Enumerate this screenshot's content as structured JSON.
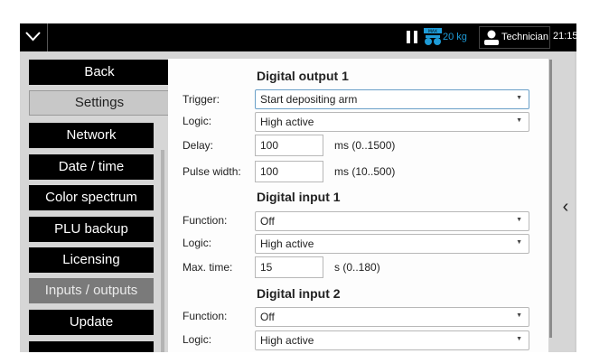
{
  "topbar": {
    "menu_icon": "chevron-down-icon",
    "pause_icon": "pause-icon",
    "scale_icon": "scale-max-icon",
    "scale_weight": "20 kg",
    "user_icon": "user-icon",
    "user_role": "Technician",
    "time": "21:15"
  },
  "sidebar": {
    "back_label": "Back",
    "settings_label": "Settings",
    "items": [
      {
        "label": "Network"
      },
      {
        "label": "Date / time"
      },
      {
        "label": "Color spectrum"
      },
      {
        "label": "PLU backup"
      },
      {
        "label": "Licensing"
      },
      {
        "label": "Inputs / outputs",
        "active": true
      },
      {
        "label": "Update"
      }
    ]
  },
  "form": {
    "digital_output_1": {
      "title": "Digital output 1",
      "trigger_label": "Trigger:",
      "trigger_value": "Start depositing arm",
      "logic_label": "Logic:",
      "logic_value": "High active",
      "delay_label": "Delay:",
      "delay_value": "100",
      "delay_range": "ms (0..1500)",
      "pulse_label": "Pulse width:",
      "pulse_value": "100",
      "pulse_range": "ms (10..500)"
    },
    "digital_input_1": {
      "title": "Digital input 1",
      "function_label": "Function:",
      "function_value": "Off",
      "logic_label": "Logic:",
      "logic_value": "High active",
      "maxtime_label": "Max. time:",
      "maxtime_value": "15",
      "maxtime_range": "s (0..180)"
    },
    "digital_input_2": {
      "title": "Digital input 2",
      "function_label": "Function:",
      "function_value": "Off",
      "logic_label": "Logic:",
      "logic_value": "High active"
    }
  },
  "collapse_handle": "‹",
  "colors": {
    "topbar": "#000000",
    "accent": "#1e9bd7",
    "nav_button": "#000000",
    "nav_active": "#7a7a7a",
    "panel_bg": "#d6d6d6"
  }
}
